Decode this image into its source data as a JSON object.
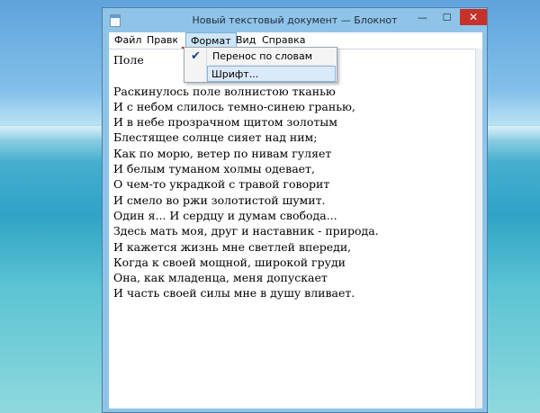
{
  "window": {
    "title": "Новый текстовый документ — Блокнот",
    "minimize_glyph": "—",
    "maximize_glyph": "☐",
    "close_glyph": "✕"
  },
  "menubar": {
    "file": "Файл",
    "edit": "Правка",
    "format": "Формат",
    "view": "Вид",
    "help": "Справка"
  },
  "format_menu": {
    "items": [
      {
        "label": "Перенос по словам",
        "checked": true,
        "check_glyph": "✔"
      },
      {
        "label": "Шрифт...",
        "checked": false,
        "hovered": true
      }
    ]
  },
  "document": {
    "lines": [
      "Поле",
      "",
      "Раскинулось поле волнистою тканью",
      "И с небом слилось темно-синею гранью,",
      "И в небе прозрачном щитом золотым",
      "Блестящее солнце сияет над ним;",
      "Как по морю, ветер по нивам гуляет",
      "И белым туманом холмы одевает,",
      "О чем-то украдкой с травой говорит",
      "И смело во ржи золотистой шумит.",
      "Один я... И сердцу и думам свобода...",
      "Здесь мать моя, друг и наставник - природа.",
      "И кажется жизнь мне светлей впереди,",
      "Когда к своей мощной, широкой груди",
      "Она, как младенца, меня допускает",
      "И часть своей силы мне в душу вливает."
    ]
  },
  "colors": {
    "highlight_box": "#e4162d",
    "close_button": "#c6312a"
  }
}
